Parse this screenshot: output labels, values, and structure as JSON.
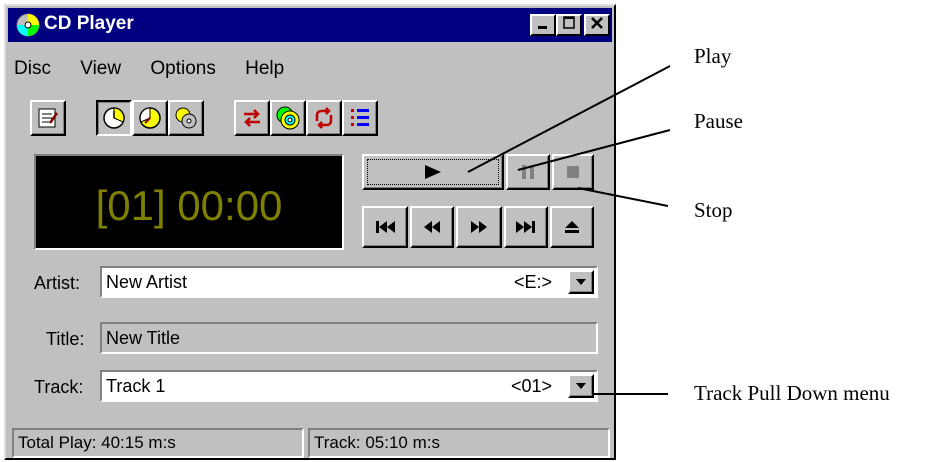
{
  "window": {
    "title": "CD Player"
  },
  "menu": {
    "disc": "Disc",
    "view": "View",
    "options": "Options",
    "help": "Help"
  },
  "display": {
    "readout": "[01] 00:00"
  },
  "fields": {
    "artist_label": "Artist:",
    "artist_value": "New Artist",
    "artist_drive": "<E:>",
    "title_label": "Title:",
    "title_value": "New Title",
    "track_label": "Track:",
    "track_value": "Track 1",
    "track_number": "<01>"
  },
  "status": {
    "total_play": "Total Play: 40:15 m:s",
    "track": "Track: 05:10 m:s"
  },
  "callouts": {
    "play": "Play",
    "pause": "Pause",
    "stop": "Stop",
    "track_menu": "Track Pull Down menu"
  },
  "colors": {
    "title_bar": "#000080",
    "face": "#c0c0c0",
    "display_bg": "#000000",
    "display_text": "#808000"
  }
}
